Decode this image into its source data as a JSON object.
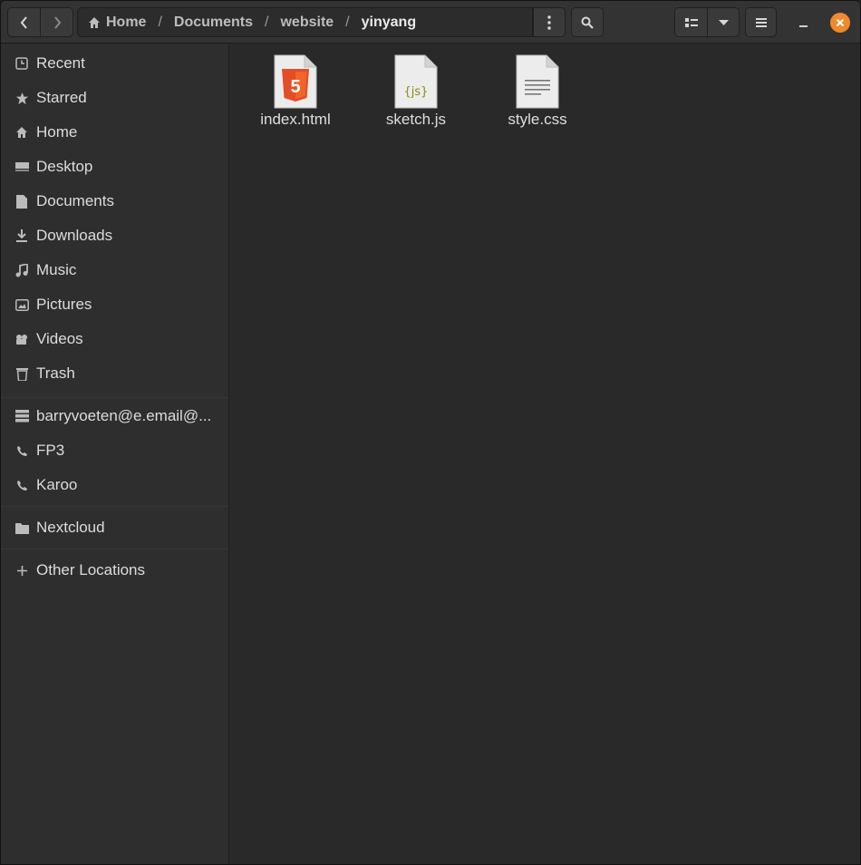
{
  "header": {
    "breadcrumb": [
      "Home",
      "Documents",
      "website",
      "yinyang"
    ],
    "separator": "/"
  },
  "sidebar": {
    "places": [
      {
        "label": "Recent",
        "icon": "recent-icon"
      },
      {
        "label": "Starred",
        "icon": "star-icon"
      },
      {
        "label": "Home",
        "icon": "home-icon"
      },
      {
        "label": "Desktop",
        "icon": "desktop-icon"
      },
      {
        "label": "Documents",
        "icon": "document-icon"
      },
      {
        "label": "Downloads",
        "icon": "download-icon"
      },
      {
        "label": "Music",
        "icon": "music-icon"
      },
      {
        "label": "Pictures",
        "icon": "pictures-icon"
      },
      {
        "label": "Videos",
        "icon": "videos-icon"
      },
      {
        "label": "Trash",
        "icon": "trash-icon"
      }
    ],
    "devices": [
      {
        "label": "barryvoeten@e.email@...",
        "icon": "server-icon"
      },
      {
        "label": "FP3",
        "icon": "phone-icon"
      },
      {
        "label": "Karoo",
        "icon": "phone-icon"
      }
    ],
    "network": [
      {
        "label": "Nextcloud",
        "icon": "folder-icon"
      }
    ],
    "other": {
      "label": "Other Locations",
      "icon": "plus-icon"
    }
  },
  "files": [
    {
      "name": "index.html",
      "icon": "html5-file-icon",
      "badge": "5"
    },
    {
      "name": "sketch.js",
      "icon": "javascript-file-icon",
      "badge": "{js}"
    },
    {
      "name": "style.css",
      "icon": "text-file-icon",
      "badge": ""
    }
  ],
  "colors": {
    "accent_close": "#f08a2c",
    "html5_orange": "#e44d26",
    "js_olive": "#8a8a1a"
  }
}
